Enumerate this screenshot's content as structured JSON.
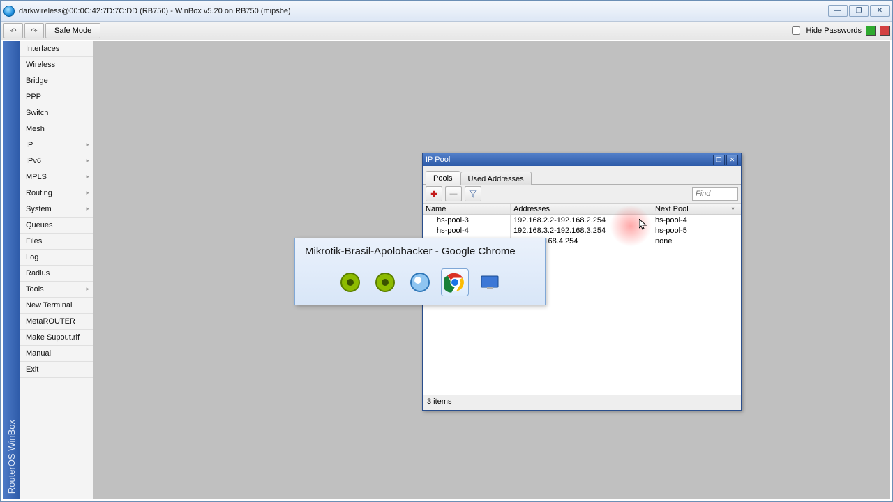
{
  "title": "darkwireless@00:0C:42:7D:7C:DD (RB750) - WinBox v5.20 on RB750 (mipsbe)",
  "toolbar": {
    "safe_mode": "Safe Mode",
    "hide_passwords": "Hide Passwords"
  },
  "sidebar_title": "RouterOS WinBox",
  "menu": [
    "Interfaces",
    "Wireless",
    "Bridge",
    "PPP",
    "Switch",
    "Mesh",
    "IP",
    "IPv6",
    "MPLS",
    "Routing",
    "System",
    "Queues",
    "Files",
    "Log",
    "Radius",
    "Tools",
    "New Terminal",
    "MetaROUTER",
    "Make Supout.rif",
    "Manual",
    "Exit"
  ],
  "menu_has_sub": {
    "IP": true,
    "IPv6": true,
    "MPLS": true,
    "Routing": true,
    "System": true,
    "Tools": true
  },
  "ip_pool": {
    "title": "IP Pool",
    "tabs": [
      "Pools",
      "Used Addresses"
    ],
    "find_placeholder": "Find",
    "columns": [
      "Name",
      "Addresses",
      "Next Pool"
    ],
    "rows": [
      {
        "name": "hs-pool-3",
        "addresses": "192.168.2.2-192.168.2.254",
        "next": "hs-pool-4"
      },
      {
        "name": "hs-pool-4",
        "addresses": "192.168.3.2-192.168.3.254",
        "next": "hs-pool-5"
      },
      {
        "name": "",
        "addresses": ".4.2-192.168.4.254",
        "next": "none"
      }
    ],
    "status": "3 items"
  },
  "tooltip": {
    "title": "Mikrotik-Brasil-Apolohacker - Google Chrome"
  },
  "colors": {
    "accent": "#2d5aa8",
    "status_green": "#2faa2f",
    "status_red": "#d34141"
  }
}
